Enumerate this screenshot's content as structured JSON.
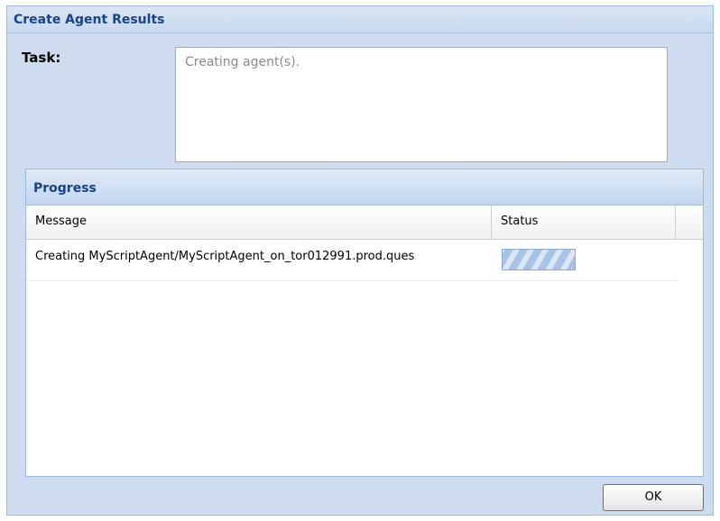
{
  "window": {
    "title": "Create Agent Results"
  },
  "task": {
    "label": "Task:",
    "value": "Creating agent(s)."
  },
  "progress": {
    "title": "Progress",
    "columns": {
      "message": "Message",
      "status": "Status"
    },
    "rows": [
      {
        "message": "Creating MyScriptAgent/MyScriptAgent_on_tor012991.prod.ques",
        "status": "in-progress"
      }
    ]
  },
  "footer": {
    "ok_label": "OK"
  },
  "colors": {
    "title_text": "#15428b",
    "dialog_background": "#cfdcef",
    "border_accent": "#99bbe8"
  }
}
